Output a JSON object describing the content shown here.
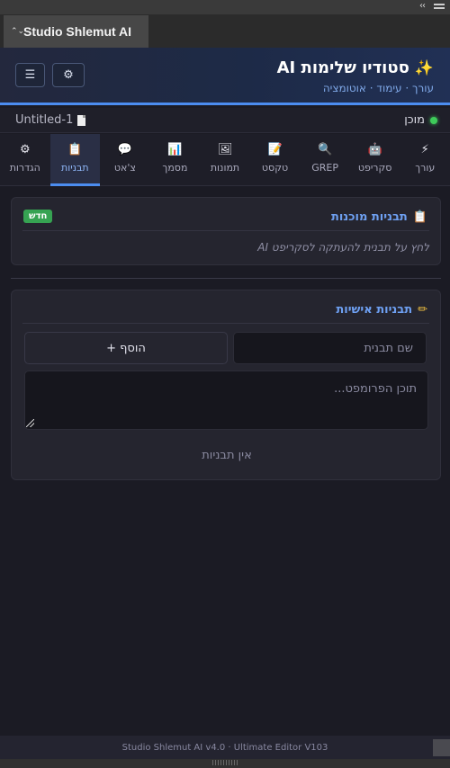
{
  "host": {
    "collapse_glyph": "‹‹",
    "panel_tab_arrows": "⌃⌄",
    "panel_tab_label": "Studio Shlemut AI"
  },
  "header": {
    "title": "סטודיו שלימות AI",
    "title_icon": "sparkle-icon",
    "subtitle": "עורך · עימוד · אוטומציה",
    "menu_glyph": "☰",
    "settings_glyph": "⚙"
  },
  "status": {
    "text": "מוכן",
    "dot_color": "#3ecb5a",
    "document": "Untitled-1"
  },
  "nav": {
    "active": "templates",
    "items": [
      {
        "id": "editor",
        "label": "עורך",
        "icon": "⚡"
      },
      {
        "id": "script",
        "label": "סקריפט",
        "icon": "🤖"
      },
      {
        "id": "grep",
        "label": "GREP",
        "icon": "🔍"
      },
      {
        "id": "text",
        "label": "טקסט",
        "icon": "📝"
      },
      {
        "id": "images",
        "label": "תמונות",
        "icon": "🖼"
      },
      {
        "id": "document",
        "label": "מסמך",
        "icon": "📊"
      },
      {
        "id": "chat",
        "label": "צ'אט",
        "icon": "💬"
      },
      {
        "id": "templates",
        "label": "תבניות",
        "icon": "📋"
      },
      {
        "id": "settings",
        "label": "הגדרות",
        "icon": "⚙"
      }
    ]
  },
  "ready_templates": {
    "title": "תבניות מוכנות",
    "icon": "📋",
    "badge": "חדש",
    "hint": "לחץ על תבנית להעתקה לסקריפט AI"
  },
  "custom_templates": {
    "title": "תבניות אישיות",
    "icon": "✏",
    "name_placeholder": "שם תבנית",
    "add_button": "+ הוסף",
    "content_placeholder": "תוכן הפרומפט...",
    "empty_message": "אין תבניות"
  },
  "footer": {
    "text": "Studio Shlemut AI v4.0 · Ultimate Editor V103"
  },
  "colors": {
    "accent": "#4c8df0",
    "panel_bg": "#1b1b24",
    "card_bg": "#25252f",
    "badge_green": "#36a352"
  }
}
